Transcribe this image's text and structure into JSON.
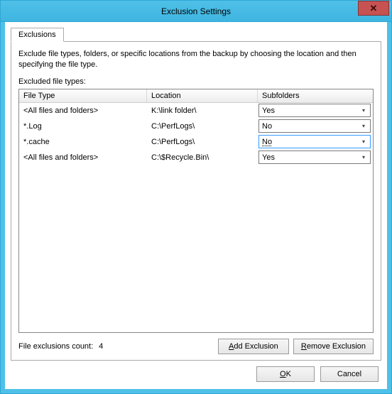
{
  "window": {
    "title": "Exclusion Settings",
    "close_symbol": "✕"
  },
  "tab": {
    "label": "Exclusions"
  },
  "description": "Exclude file types, folders, or specific locations from the backup by choosing the location and then specifying the file type.",
  "excluded_label": "Excluded file types:",
  "columns": {
    "file_type": "File Type",
    "location": "Location",
    "subfolders": "Subfolders"
  },
  "rows": [
    {
      "file_type": "<All files and folders>",
      "location": "K:\\link folder\\",
      "subfolders": "Yes",
      "focused": false
    },
    {
      "file_type": "*.Log",
      "location": "C:\\PerfLogs\\",
      "subfolders": "No",
      "focused": false
    },
    {
      "file_type": "*.cache",
      "location": "C:\\PerfLogs\\",
      "subfolders": "No",
      "focused": true
    },
    {
      "file_type": "<All files and folders>",
      "location": "C:\\$Recycle.Bin\\",
      "subfolders": "Yes",
      "focused": false
    }
  ],
  "count_label": "File exclusions count:",
  "count_value": "4",
  "buttons": {
    "add": {
      "accel": "A",
      "rest": "dd Exclusion"
    },
    "remove": {
      "accel": "R",
      "rest": "emove Exclusion"
    },
    "ok": {
      "accel": "O",
      "rest": "K"
    },
    "cancel": "Cancel"
  }
}
